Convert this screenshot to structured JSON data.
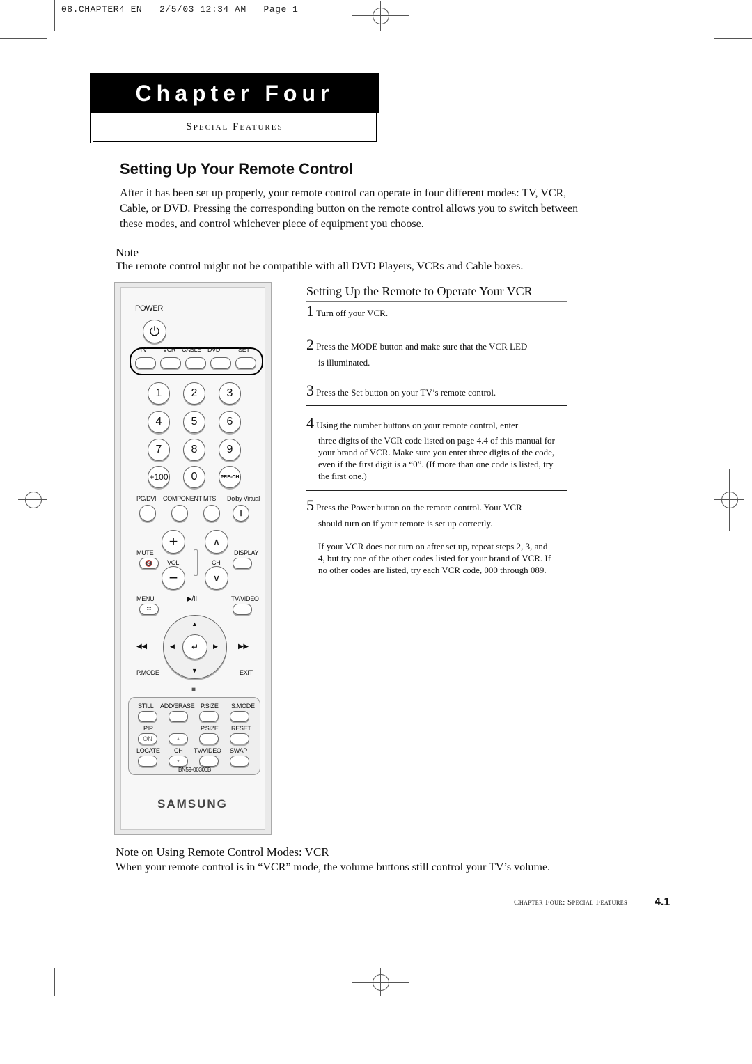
{
  "slug": "08.CHAPTER4_EN   2/5/03 12:34 AM   Page 1",
  "chapter": {
    "title": "Chapter Four",
    "subtitle": "Special Features"
  },
  "section": {
    "title": "Setting Up Your Remote Control",
    "intro": "After it has been set up properly, your remote control can operate in four different modes: TV, VCR, Cable, or DVD. Pressing the corresponding button on the remote control allows you to switch between these modes, and control whichever piece of equipment you choose."
  },
  "note": {
    "heading": "Note",
    "text": "The remote control might not be compatible with all DVD Players, VCRs and Cable boxes."
  },
  "remote": {
    "power_label": "POWER",
    "modes": [
      "TV",
      "VCR",
      "CABLE",
      "DVD",
      "SET"
    ],
    "keypad": [
      "1",
      "2",
      "3",
      "4",
      "5",
      "6",
      "7",
      "8",
      "9",
      "+100",
      "0",
      "PRE-CH"
    ],
    "row_labels": [
      "PC/DVI",
      "COMPONENT",
      "MTS",
      "Dolby Virtual"
    ],
    "mute": "MUTE",
    "display": "DISPLAY",
    "vol": "VOL",
    "ch": "CH",
    "menu": "MENU",
    "play_pause": "▶/II",
    "tv_video": "TV/VIDEO",
    "pmode": "P.MODE",
    "exit": "EXIT",
    "lower_row1": [
      "STILL",
      "ADD/ERASE",
      "P.SIZE",
      "S.MODE"
    ],
    "pip": "PIP",
    "psize2": "P.SIZE",
    "reset": "RESET",
    "on": "ON",
    "lower_row3": [
      "LOCATE",
      "CH",
      "TV/VIDEO",
      "SWAP"
    ],
    "model": "BN59-00306B",
    "brand": "SAMSUNG"
  },
  "steps": {
    "title": "Setting Up the Remote to Operate Your VCR",
    "items": [
      {
        "num": "1",
        "first": "Turn off your VCR.",
        "rest": ""
      },
      {
        "num": "2",
        "first": "Press the MODE button and make sure that the VCR LED",
        "rest": "is illuminated."
      },
      {
        "num": "3",
        "first": "Press the Set button on your TV’s remote control.",
        "rest": ""
      },
      {
        "num": "4",
        "first": "Using the number buttons on your remote control, enter",
        "rest": "three digits of the VCR code listed on page 4.4 of this manual for your brand of VCR. Make sure you enter three digits of the code, even if the first digit is a “0”. (If more than one code is listed, try the first one.)"
      },
      {
        "num": "5",
        "first": "Press the Power button on the remote control. Your VCR",
        "rest": "should turn on if your remote is set up correctly."
      }
    ],
    "followup": "If your  VCR does not turn on after set up, repeat steps 2, 3, and 4, but try one of the other codes listed for your brand of VCR. If no other codes are listed, try each VCR code, 000 through 089."
  },
  "bottom_note": {
    "heading": "Note on Using Remote Control Modes: VCR",
    "text": "When your remote control is in “VCR” mode, the volume buttons still control your TV’s volume."
  },
  "footer": {
    "label": "Chapter Four: Special Features",
    "page": "4.1"
  }
}
